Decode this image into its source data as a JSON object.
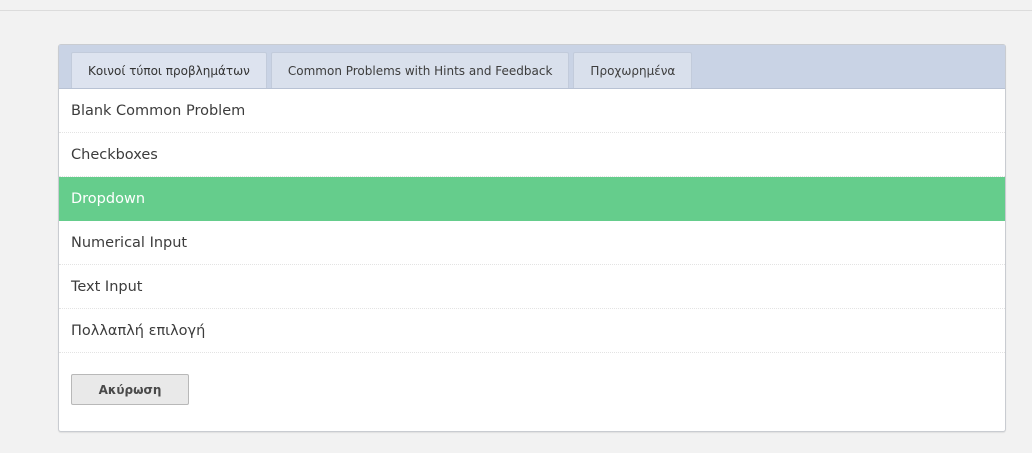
{
  "tabs": [
    {
      "label": "Κοινοί τύποι προβλημάτων",
      "active": true
    },
    {
      "label": "Common Problems with Hints and Feedback",
      "active": false
    },
    {
      "label": "Προχωρημένα",
      "active": false
    }
  ],
  "problems": [
    {
      "label": "Blank Common Problem",
      "selected": false
    },
    {
      "label": "Checkboxes",
      "selected": false
    },
    {
      "label": "Dropdown",
      "selected": true
    },
    {
      "label": "Numerical Input",
      "selected": false
    },
    {
      "label": "Text Input",
      "selected": false
    },
    {
      "label": "Πολλαπλή επιλογή",
      "selected": false
    }
  ],
  "cancel_label": "Ακύρωση",
  "colors": {
    "selected_bg": "#65cd8c",
    "tab_bar_bg": "#c9d3e5",
    "page_bg": "#f2f2f2"
  }
}
